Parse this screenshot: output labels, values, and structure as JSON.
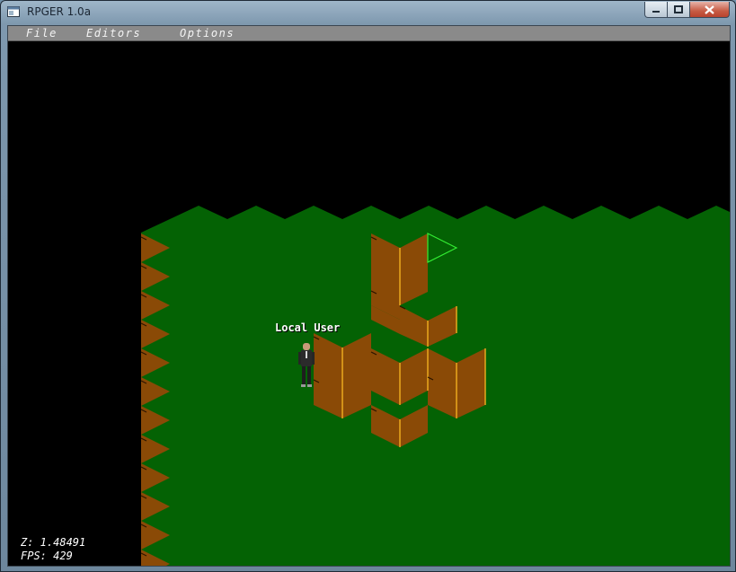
{
  "window": {
    "title": "RPGER 1.0a",
    "icons": {
      "app": "app-window-icon",
      "minimize": "minimize-icon",
      "maximize": "maximize-icon",
      "close": "close-icon"
    }
  },
  "menu": {
    "file": "File",
    "editors": "Editors",
    "options": "Options"
  },
  "scene": {
    "player_name": "Local User"
  },
  "hud": {
    "z_line": "Z: 1.48491",
    "fps_line": "FPS: 429"
  },
  "colors": {
    "ground": "#046204",
    "wall": "#8a4a06",
    "wall_edge": "#f0b020",
    "selection": "#33ee33",
    "background": "#000000"
  }
}
